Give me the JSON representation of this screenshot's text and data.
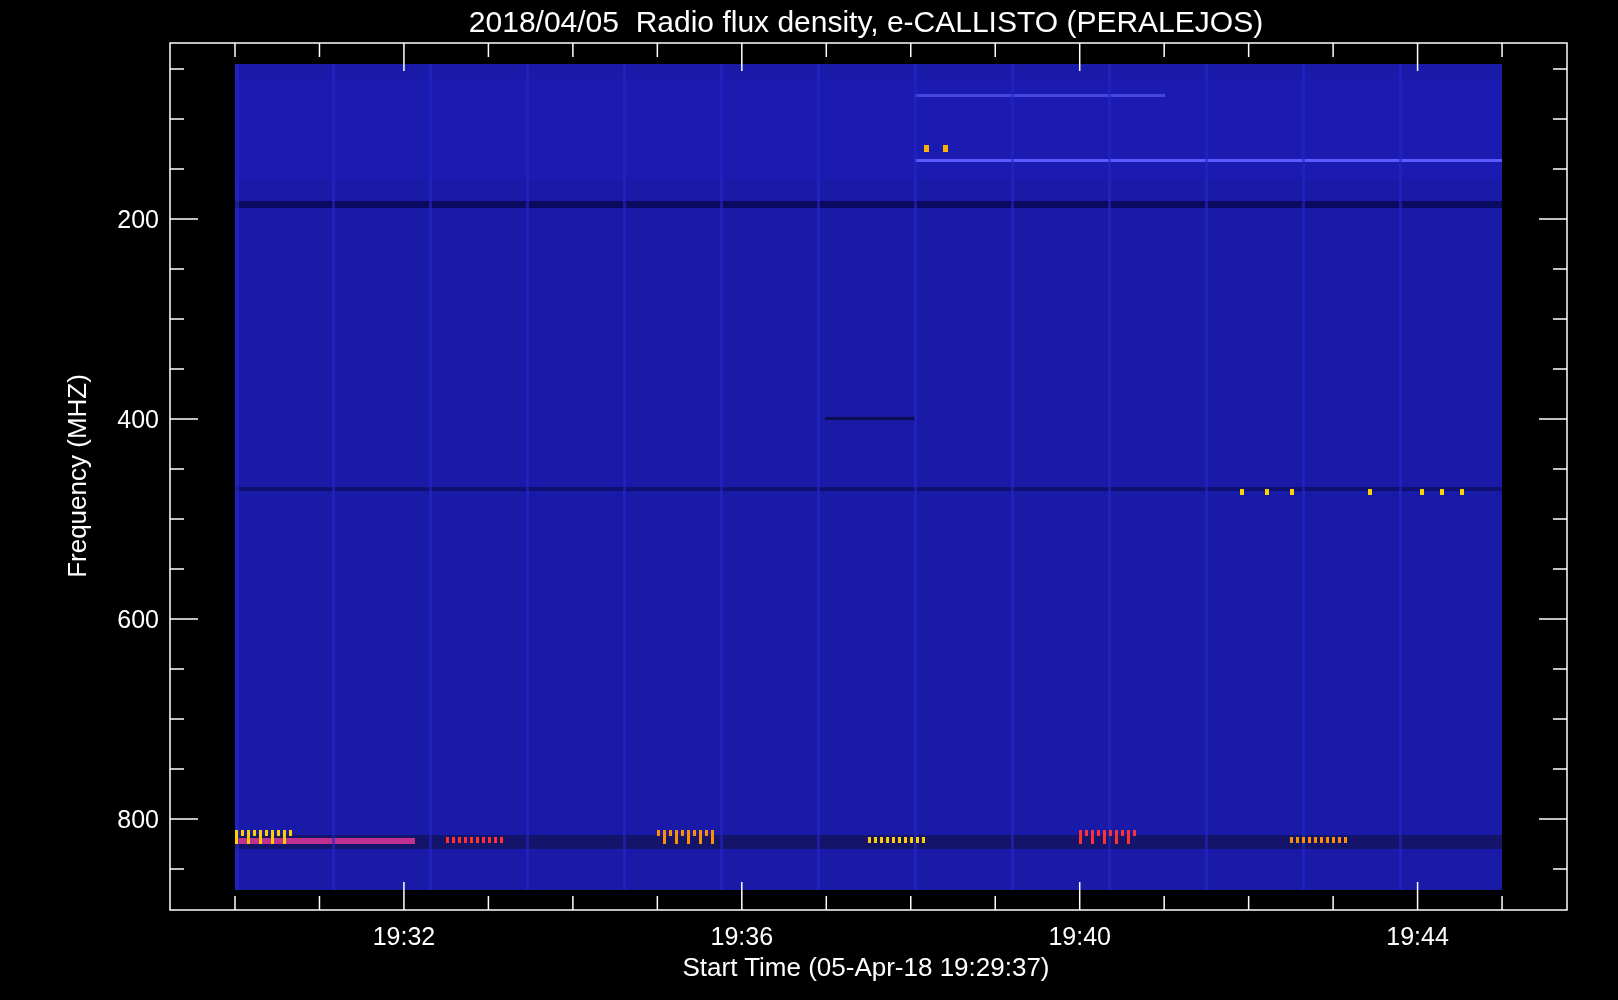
{
  "title": "2018/04/05  Radio flux density, e-CALLISTO (PERALEJOS)",
  "plot": {
    "ylabel": "Frequency (MHZ)",
    "xlabel": "Start Time (05-Apr-18 19:29:37)",
    "yticks": [
      "200",
      "400",
      "600",
      "800"
    ],
    "xticks": [
      "19:32",
      "19:36",
      "19:40",
      "19:44"
    ]
  }
}
